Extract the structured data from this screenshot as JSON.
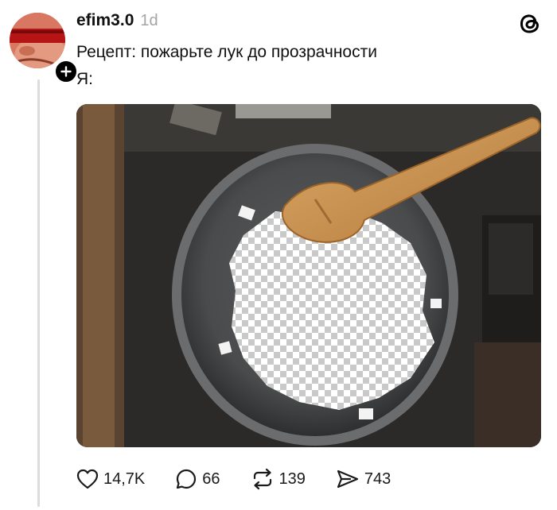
{
  "post": {
    "username": "efim3.0",
    "timestamp": "1d",
    "lines": [
      "Рецепт: пожарьте лук до прозрачности",
      "Я:"
    ],
    "image_icon": "photo-frying-pan-transparent-onions"
  },
  "app": {
    "logo_icon": "threads-logo-icon"
  },
  "actions": {
    "likes": "14,7K",
    "replies": "66",
    "reposts": "139",
    "shares": "743"
  },
  "colors": {
    "text": "#111111",
    "muted": "#a4a4a4",
    "thread_line": "#dcdcdc",
    "badge": "#000000"
  }
}
